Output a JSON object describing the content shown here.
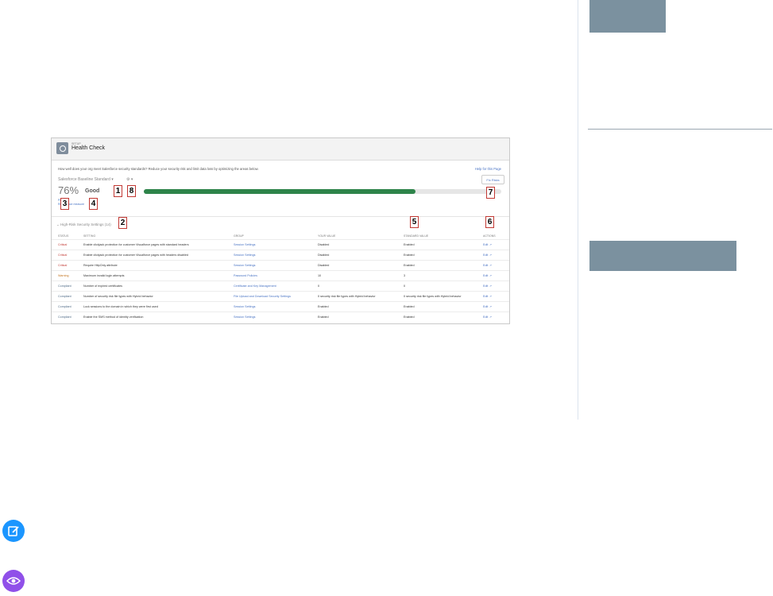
{
  "health_check": {
    "setup_label": "SETUP",
    "title": "Health Check",
    "intro": "How well does your org meet Salesforce security standards? Reduce your security risk and limit data loss by optimizing the areas below.",
    "help_link": "Help for this Page",
    "baseline_dropdown": "Salesforce Baseline Standard",
    "settings_dropdown": "⚙ ▾",
    "fix_risks_button": "Fix Risks",
    "score": "76%",
    "rating": "Good",
    "risk_text": "Personal\nRisk reduce measure",
    "progress_fraction": 0.76,
    "section_title": "High-Risk Security Settings (14)",
    "columns": [
      "STATUS",
      "SETTING",
      "GROUP",
      "YOUR VALUE",
      "STANDARD VALUE",
      "ACTIONS"
    ],
    "rows": [
      {
        "status": "Critical",
        "setting": "Enable clickjack protection for customer Visualforce pages with standard headers",
        "group": "Session Settings",
        "your_value": "Disabled",
        "standard_value": "Enabled",
        "action": "Edit"
      },
      {
        "status": "Critical",
        "setting": "Enable clickjack protection for customer Visualforce pages with headers disabled",
        "group": "Session Settings",
        "your_value": "Disabled",
        "standard_value": "Enabled",
        "action": "Edit"
      },
      {
        "status": "Critical",
        "setting": "Require HttpOnly attribute",
        "group": "Session Settings",
        "your_value": "Disabled",
        "standard_value": "Enabled",
        "action": "Edit"
      },
      {
        "status": "Warning",
        "setting": "Maximum invalid login attempts",
        "group": "Password Policies",
        "your_value": "10",
        "standard_value": "3",
        "action": "Edit"
      },
      {
        "status": "Compliant",
        "setting": "Number of expired certificates",
        "group": "Certificate and Key Management",
        "your_value": "0",
        "standard_value": "0",
        "action": "Edit"
      },
      {
        "status": "Compliant",
        "setting": "Number of security risk file types with Hybrid behavior",
        "group": "File Upload and Download Security Settings",
        "your_value": "0 security risk file types with Hybrid behavior",
        "standard_value": "0 security risk file types with Hybrid behavior",
        "action": "Edit"
      },
      {
        "status": "Compliant",
        "setting": "Lock sessions to the domain in which they were first used",
        "group": "Session Settings",
        "your_value": "Enabled",
        "standard_value": "Enabled",
        "action": "Edit"
      },
      {
        "status": "Compliant",
        "setting": "Enable the SMS method of identity verification",
        "group": "Session Settings",
        "your_value": "Enabled",
        "standard_value": "Enabled",
        "action": "Edit"
      }
    ]
  },
  "callouts": [
    "1",
    "2",
    "3",
    "4",
    "5",
    "6",
    "7",
    "8"
  ],
  "icons": {
    "edit": "edit-note-icon",
    "view": "eye-icon",
    "settings": "gear-icon",
    "external": "external-link-icon"
  },
  "colors": {
    "edit_icon_bg": "#1b96ff",
    "view_icon_bg": "#9050e9",
    "progress": "#2e844a",
    "callout_border": "#c23934",
    "sidebar_block": "#7b919f"
  }
}
